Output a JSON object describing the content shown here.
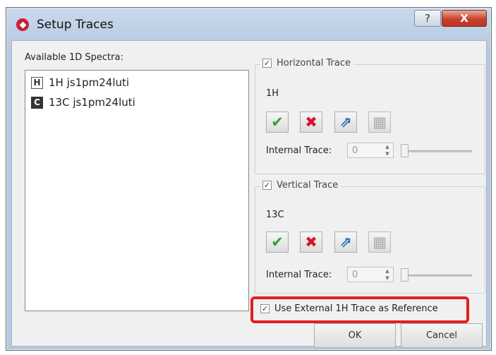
{
  "window": {
    "title": "Setup Traces",
    "help_label": "?",
    "close_label": "X"
  },
  "spectra": {
    "label": "Available 1D Spectra:",
    "items": [
      {
        "badge": "H",
        "name": "1H js1pm24luti"
      },
      {
        "badge": "C",
        "name": "13C js1pm24luti"
      }
    ]
  },
  "horizontal": {
    "legend": "Horizontal Trace",
    "checked": true,
    "nucleus": "1H",
    "internal_trace_label": "Internal Trace:",
    "internal_trace_value": "0"
  },
  "vertical": {
    "legend": "Vertical Trace",
    "checked": true,
    "nucleus": "13C",
    "internal_trace_label": "Internal Trace:",
    "internal_trace_value": "0"
  },
  "reference": {
    "label": "Use External 1H Trace as Reference",
    "checked": true
  },
  "buttons": {
    "ok": "OK",
    "cancel": "Cancel"
  },
  "glyphs": {
    "check": "✔",
    "cross": "✖",
    "export": "⇗",
    "settings": "▦",
    "checkbox": "✓"
  },
  "colors": {
    "highlight": "#e02020",
    "accept": "#35a030",
    "reject": "#d5172a"
  }
}
